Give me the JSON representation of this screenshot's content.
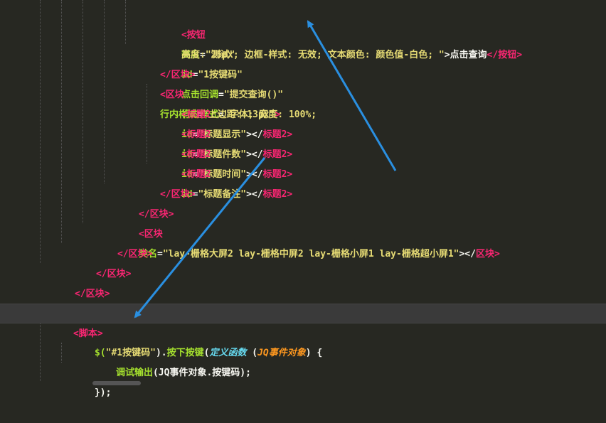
{
  "colors": {
    "background": "#272822",
    "tag": "#f92672",
    "attribute": "#a6e22e",
    "string": "#e6db74",
    "keyword": "#66d9ef",
    "parameter": "#fd971f",
    "arrow": "#2a8fe0"
  },
  "code": {
    "line1": {
      "open": "<",
      "tag": "按钮",
      "a1": "类名",
      "v1": "\"测试\"",
      "a2": "id",
      "v2": "\"1按键码\"",
      "a3": "点击回调",
      "v3": "\"提交查询()\"",
      "a4": "行内样式",
      "v4": "\"字体; 宽度: 100%;"
    },
    "line2": {
      "v4cont": "高度: 25px; 边框-样式: 无效; 文本颜色: 颜色值-白色; \"",
      "gt": ">",
      "text": "点击查询",
      "close": "</",
      "tag": "按钮",
      "end": ">"
    },
    "line3": {
      "close": "</",
      "tag": "区块",
      "end": ">"
    },
    "line4": {
      "open": "<",
      "tag": "区块",
      "a1": "行内样式",
      "v1": "\"上边距: 13px\"",
      "end": ">"
    },
    "line5": {
      "open": "<",
      "tag": "标题2",
      "a1": "id",
      "v1": "\"标题显示\"",
      "mid": "></",
      "ctag": "标题2",
      "end": ">"
    },
    "line6": {
      "open": "<",
      "tag": "标题2",
      "a1": "id",
      "v1": "\"标题件数\"",
      "mid": "></",
      "ctag": "标题2",
      "end": ">"
    },
    "line7": {
      "open": "<",
      "tag": "标题2",
      "a1": "id",
      "v1": "\"标题时间\"",
      "mid": "></",
      "ctag": "标题2",
      "end": ">"
    },
    "line8": {
      "open": "<",
      "tag": "标题2",
      "a1": "id",
      "v1": "\"标题备注\"",
      "mid": "></",
      "ctag": "标题2",
      "end": ">"
    },
    "line9": {
      "close": "</",
      "tag": "区块",
      "end": ">"
    },
    "line10": {
      "close": "</",
      "tag": "区块",
      "end": ">"
    },
    "line11": {
      "open": "<",
      "tag": "区块",
      "a1": "类名",
      "v1": "\"lay-栅格大屏2 lay-栅格中屏2 lay-栅格小屏1 lay-栅格超小屏1\"",
      "mid": "></",
      "ctag": "区块",
      "end": ">"
    },
    "line12": {
      "close": "</",
      "tag": "区块",
      "end": ">"
    },
    "line13": {
      "close": "</",
      "tag": "区块",
      "end": ">"
    },
    "line14": {
      "close": "</",
      "tag": "区块",
      "end": ">"
    },
    "line16": {
      "open": "<",
      "tag": "脚本",
      "end": ">"
    },
    "line17": {
      "dollar": "$(",
      "sel": "\"#1按键码\"",
      "mid": ").",
      "method": "按下按键",
      "paren": "(",
      "kw": "定义函数",
      "lp": " (",
      "param": "JQ事件对象",
      "rp": ") {"
    },
    "line18": {
      "fn": "调试输出",
      "args": "(JQ事件对象.按键码);"
    },
    "line19": {
      "text": "});"
    }
  }
}
